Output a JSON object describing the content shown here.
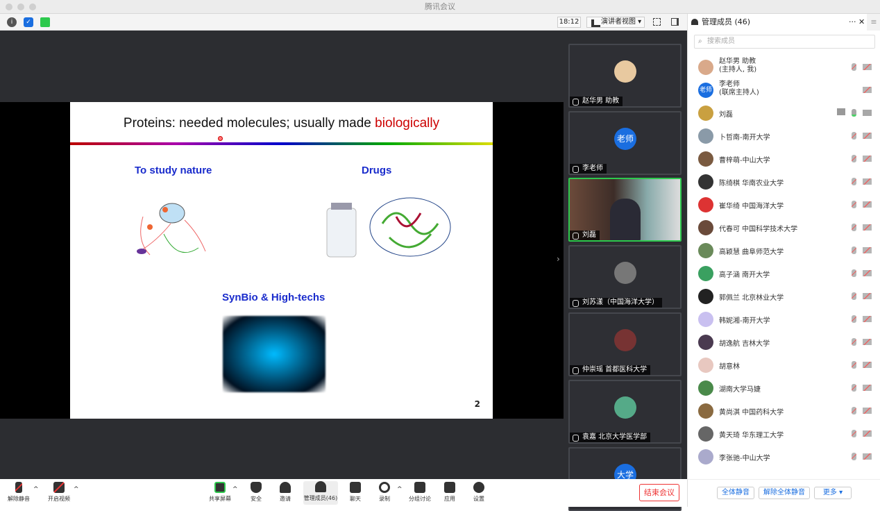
{
  "window": {
    "title": "腾讯会议"
  },
  "topbar": {
    "timer": "18:12",
    "view_mode": "演讲者视图"
  },
  "slide": {
    "title_plain": "Proteins: needed molecules; usually made ",
    "title_highlight": "biologically",
    "sections": [
      "To study nature",
      "Drugs",
      "SynBio & High-techs"
    ],
    "page_number": "2"
  },
  "video_tiles": [
    {
      "name": "赵华男 助教",
      "avatar": ""
    },
    {
      "name": "李老师",
      "avatar": "老师"
    },
    {
      "name": "刘磊",
      "avatar": "",
      "active": true
    },
    {
      "name": "刘苏漾（中国海洋大学）",
      "avatar": ""
    },
    {
      "name": "仲崇瑶 首都医科大学",
      "avatar": ""
    },
    {
      "name": "袁嘉 北京大学医学部",
      "avatar": ""
    },
    {
      "name": "",
      "avatar": "大学"
    }
  ],
  "panel": {
    "title": "管理成员 (46)",
    "search_placeholder": "搜索成员",
    "members": [
      {
        "name": "赵华男 助教",
        "role": "(主持人, 我)"
      },
      {
        "name": "李老师",
        "role": "(联席主持人)",
        "avatar": "老师"
      },
      {
        "name": "刘磊",
        "mic_on": true
      },
      {
        "name": "卜哲南-南开大学"
      },
      {
        "name": "曹梓萌-中山大学"
      },
      {
        "name": "陈绮棋 华南农业大学"
      },
      {
        "name": "崔华绮 中国海洋大学"
      },
      {
        "name": "代春可 中国科学技术大学"
      },
      {
        "name": "高颖慧 曲阜师范大学"
      },
      {
        "name": "高子涵 南开大学"
      },
      {
        "name": "郭佩兰 北京林业大学"
      },
      {
        "name": "韩妮湘-南开大学"
      },
      {
        "name": "胡逸航 吉林大学"
      },
      {
        "name": "胡意林"
      },
      {
        "name": "湖南大学马婕"
      },
      {
        "name": "黄尚淇 中国药科大学"
      },
      {
        "name": "黄天琦 华东理工大学"
      },
      {
        "name": "李张驰-中山大学"
      }
    ],
    "footer": {
      "mute_all": "全体静音",
      "unmute_all": "解除全体静音",
      "more": "更多 ▾"
    }
  },
  "toolbar": {
    "unmute": "解除静音",
    "start_video": "开启视频",
    "share_screen": "共享屏幕",
    "security": "安全",
    "invite": "邀请",
    "manage_members": "管理成员(46)",
    "chat": "聊天",
    "record": "录制",
    "breakout": "分组讨论",
    "apps": "应用",
    "settings": "设置",
    "end_meeting": "结束会议"
  },
  "colors": {
    "accent": "#1a6ee0",
    "active_speaker": "#2dc94d",
    "end": "#e33333",
    "slide_heading": "#1a2ccc"
  }
}
